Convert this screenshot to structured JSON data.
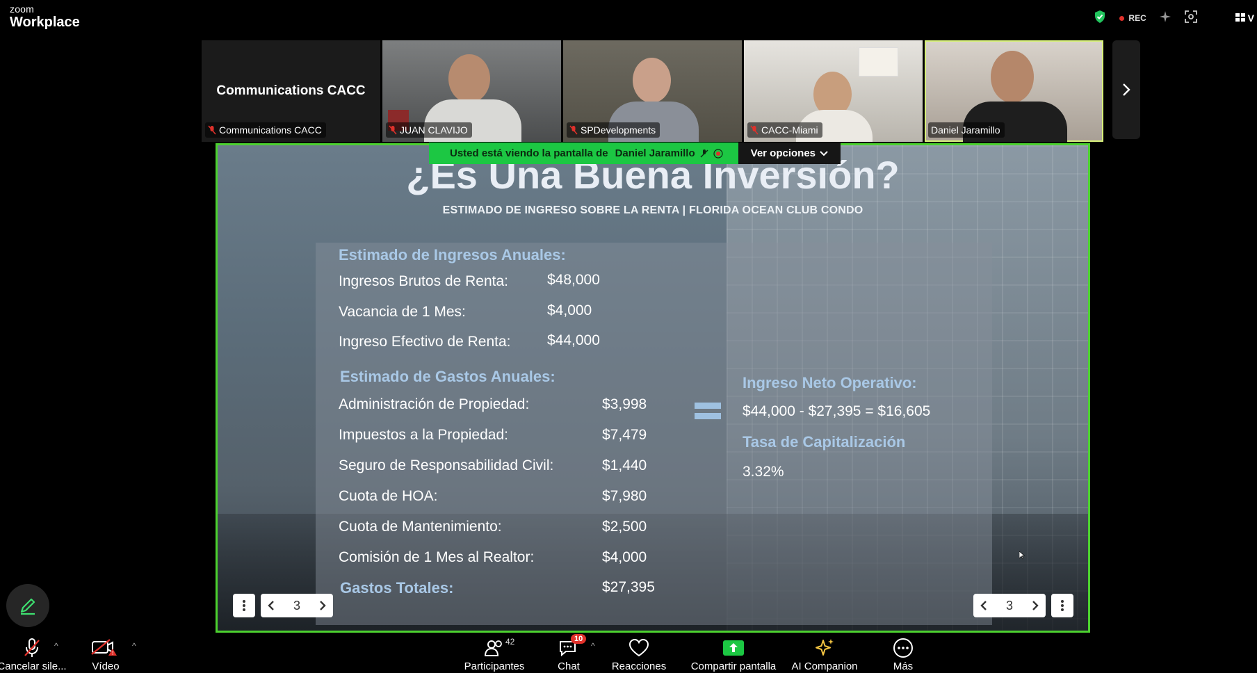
{
  "app": {
    "brand_top": "zoom",
    "brand_bottom": "Workplace"
  },
  "topbar": {
    "rec_label": "REC",
    "view_label": "V"
  },
  "thumbnails": [
    {
      "name": "Communications CACC",
      "big_name": "Communications CACC",
      "muted": true
    },
    {
      "name": "JUAN CLAVIJO",
      "muted": true
    },
    {
      "name": "SPDevelopments",
      "muted": true
    },
    {
      "name": "CACC-Miami",
      "muted": true
    },
    {
      "name": "Daniel Jaramillo",
      "muted": false
    }
  ],
  "banner": {
    "text": "Usted está viendo la pantalla de",
    "presenter": "Daniel Jaramillo",
    "options_label": "Ver opciones"
  },
  "slide": {
    "title": "¿Es Una Buena Inversión?",
    "subtitle": "ESTIMADO DE INGRESO SOBRE LA RENTA | FLORIDA OCEAN CLUB CONDO",
    "income_heading": "Estimado de Ingresos Anuales:",
    "income_rows": [
      {
        "label": "Ingresos Brutos de Renta:",
        "value": "$48,000"
      },
      {
        "label": "Vacancia de 1 Mes:",
        "value": "$4,000"
      },
      {
        "label": "Ingreso Efectivo de Renta:",
        "value": "$44,000"
      }
    ],
    "expense_heading": "Estimado de Gastos Anuales:",
    "expense_rows": [
      {
        "label": "Administración de Propiedad:",
        "value": "$3,998"
      },
      {
        "label": "Impuestos a la Propiedad:",
        "value": "$7,479"
      },
      {
        "label": "Seguro de Responsabilidad Civil:",
        "value": "$1,440"
      },
      {
        "label": "Cuota de HOA:",
        "value": "$7,980"
      },
      {
        "label": "Cuota de Mantenimiento:",
        "value": "$2,500"
      },
      {
        "label": "Comisión de 1 Mes al Realtor:",
        "value": "$4,000"
      }
    ],
    "total_label": "Gastos Totales:",
    "total_value": "$27,395",
    "noi_heading": "Ingreso Neto Operativo:",
    "noi_value": "$44,000 - $27,395 = $16,605",
    "cap_heading": "Tasa de Capitalización",
    "cap_value": "3.32%"
  },
  "slide_nav": {
    "left_page": "3",
    "right_page": "3"
  },
  "toolbar": {
    "mute_label": "Cancelar sile...",
    "video_label": "Vídeo",
    "participants_label": "Participantes",
    "participants_count": "42",
    "chat_label": "Chat",
    "chat_badge": "10",
    "reactions_label": "Reacciones",
    "share_label": "Compartir pantalla",
    "companion_label": "AI Companion",
    "more_label": "Más"
  },
  "colors": {
    "share_border": "#4cd12f",
    "banner_green": "#1cc743",
    "heading_blue": "#a9c8e6",
    "active_speaker": "#d7f07a"
  }
}
